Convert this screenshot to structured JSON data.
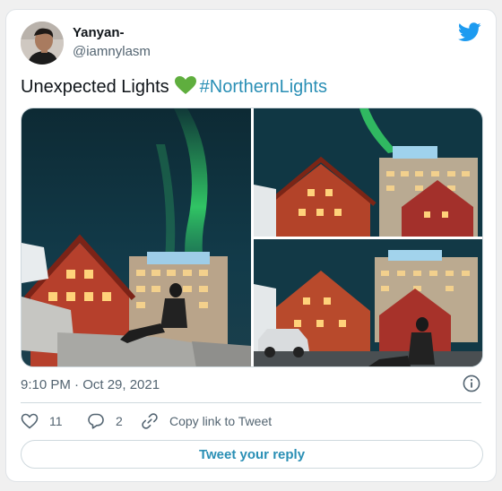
{
  "author": {
    "name": "Yanyan-",
    "handle": "@iamnylasm"
  },
  "tweet": {
    "text": "Unexpected Lights",
    "emoji": "green-heart-emoji",
    "hashtag": "#NorthernLights",
    "timestamp": "9:10 PM · Oct 29, 2021",
    "media": [
      {
        "icon": "northern-lights-photo-1"
      },
      {
        "icon": "northern-lights-photo-2"
      },
      {
        "icon": "northern-lights-photo-3"
      }
    ]
  },
  "actions": {
    "like_count": "11",
    "reply_count": "2",
    "copy_link_label": "Copy link to Tweet"
  },
  "reply_button_label": "Tweet your reply",
  "colors": {
    "brand": "#1d9bf0",
    "link": "#2a8fb5",
    "muted": "#536471",
    "heart": "#5fae3e"
  }
}
